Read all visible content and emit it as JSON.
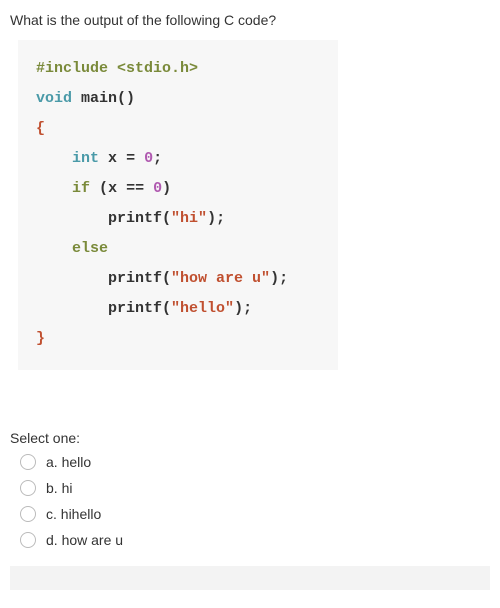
{
  "question": "What is the output of the following C code?",
  "code": {
    "lines": [
      {
        "t": [
          [
            "#include <stdio.h>",
            "preproc"
          ]
        ]
      },
      {
        "t": [
          [
            "void",
            "type"
          ],
          [
            " ",
            "sp"
          ],
          [
            "main",
            "func"
          ],
          [
            "()",
            "punc"
          ]
        ]
      },
      {
        "t": [
          [
            "{",
            "brace"
          ]
        ]
      },
      {
        "indent": "    ",
        "t": [
          [
            "int",
            "type"
          ],
          [
            " ",
            "sp"
          ],
          [
            "x",
            "ident"
          ],
          [
            " ",
            "sp"
          ],
          [
            "=",
            "op"
          ],
          [
            " ",
            "sp"
          ],
          [
            "0",
            "num"
          ],
          [
            ";",
            "punc"
          ]
        ]
      },
      {
        "indent": "    ",
        "t": [
          [
            "if",
            "keyword"
          ],
          [
            " ",
            "sp"
          ],
          [
            "(",
            "punc"
          ],
          [
            "x",
            "ident"
          ],
          [
            " ",
            "sp"
          ],
          [
            "==",
            "op"
          ],
          [
            " ",
            "sp"
          ],
          [
            "0",
            "num"
          ],
          [
            ")",
            "punc"
          ]
        ]
      },
      {
        "indent": "        ",
        "t": [
          [
            "printf",
            "call"
          ],
          [
            "(",
            "punc"
          ],
          [
            "\"hi\"",
            "str"
          ],
          [
            ")",
            "punc"
          ],
          [
            ";",
            "punc"
          ]
        ]
      },
      {
        "indent": "    ",
        "t": [
          [
            "else",
            "keyword"
          ]
        ]
      },
      {
        "indent": "        ",
        "t": [
          [
            "printf",
            "call"
          ],
          [
            "(",
            "punc"
          ],
          [
            "\"how are u\"",
            "str"
          ],
          [
            ")",
            "punc"
          ],
          [
            ";",
            "punc"
          ]
        ]
      },
      {
        "indent": "        ",
        "t": [
          [
            "printf",
            "call"
          ],
          [
            "(",
            "punc"
          ],
          [
            "\"hello\"",
            "str"
          ],
          [
            ")",
            "punc"
          ],
          [
            ";",
            "punc"
          ]
        ]
      },
      {
        "t": [
          [
            "}",
            "brace"
          ]
        ]
      }
    ]
  },
  "selectLabel": "Select one:",
  "options": [
    {
      "prefix": "a.",
      "text": "hello"
    },
    {
      "prefix": "b.",
      "text": "hi"
    },
    {
      "prefix": "c.",
      "text": "hihello"
    },
    {
      "prefix": "d.",
      "text": "how are u"
    }
  ]
}
